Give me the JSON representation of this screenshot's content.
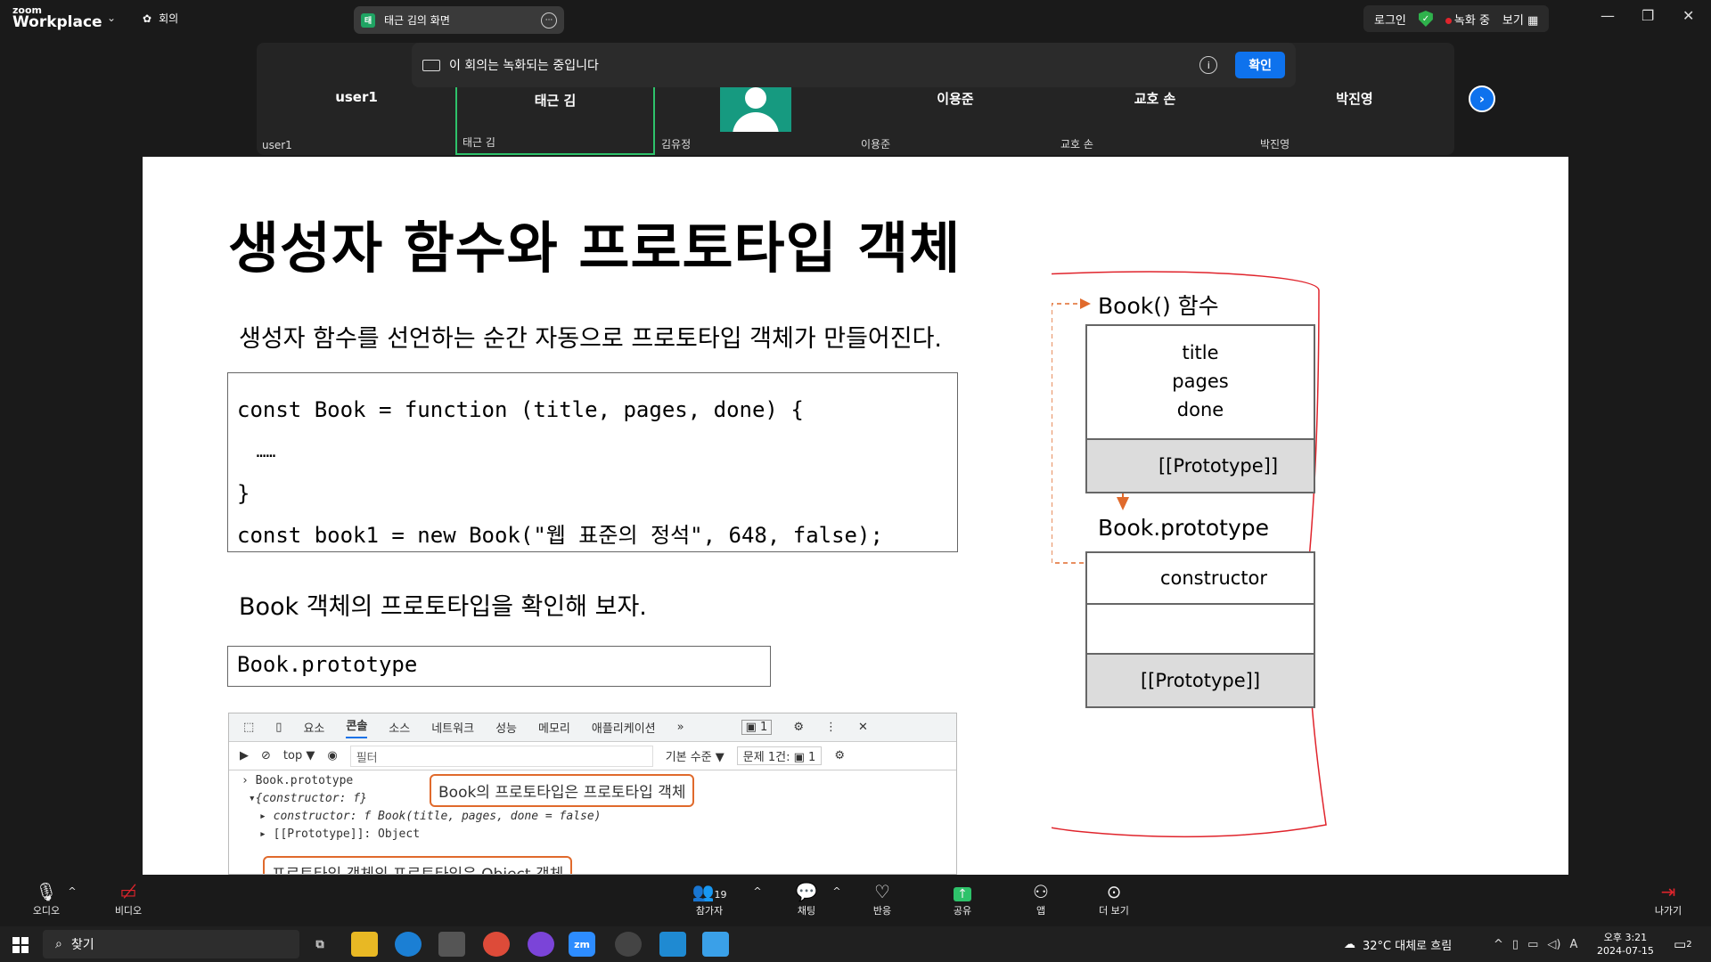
{
  "app": {
    "logo_small": "zoom",
    "logo_big": "Workplace",
    "meeting_label": "회의"
  },
  "share_tab": {
    "title": "태근 김의 화면",
    "icon_letter": "태"
  },
  "top_right": {
    "login": "로그인",
    "recording": "녹화 중",
    "view": "보기"
  },
  "notice": {
    "text": "이 회의는 녹화되는 중입니다",
    "confirm": "확인"
  },
  "participants": [
    {
      "name": "user1",
      "label": "user1"
    },
    {
      "name": "태근 김",
      "label": "태근 김"
    },
    {
      "name": "",
      "label": "김유정"
    },
    {
      "name": "이용준",
      "label": "이용준"
    },
    {
      "name": "교호 손",
      "label": "교호 손"
    },
    {
      "name": "박진영",
      "label": "박진영"
    }
  ],
  "slide": {
    "title": "생성자 함수와 프로토타입 객체",
    "subtitle": "생성자 함수를 선언하는 순간 자동으로 프로토타입 객체가 만들어진다.",
    "code_lines": [
      "const Book = function (title, pages, done) {",
      "  ……",
      "}",
      "const book1 = new Book(\"웹 표준의 정석\", 648, false);"
    ],
    "subtitle2": "Book 객체의 프로토타입을 확인해 보자.",
    "code2": "Book.prototype",
    "devtools": {
      "tabs": [
        "요소",
        "콘솔",
        "소스",
        "네트워크",
        "성능",
        "메모리",
        "애플리케이션",
        "»"
      ],
      "msg_count": "1",
      "context": "top ▼",
      "filter_placeholder": "필터",
      "level": "기본 수준 ▼",
      "issues": "문제 1건:",
      "issues_count": "1",
      "lines": [
        "Book.prototype",
        "{constructor: f}",
        "constructor: f Book(title, pages, done = false)",
        "[[Prototype]]: Object"
      ],
      "callout1": "Book의 프로토타입은 프로토타입 객체",
      "callout2": "프로토타입 객체의 프로토타입은 Object 객체"
    },
    "diagram": {
      "func_label": "Book() 함수",
      "props": [
        "title",
        "pages",
        "done"
      ],
      "proto_slot": "[[Prototype]]",
      "proto_label": "Book.prototype",
      "constructor": "constructor",
      "proto_slot2": "[[Prototype]]"
    }
  },
  "bottombar": {
    "audio": "오디오",
    "video": "비디오",
    "participants": "참가자",
    "participants_count": "19",
    "chat": "채팅",
    "react": "반응",
    "share": "공유",
    "apps": "앱",
    "more": "더 보기",
    "leave": "나가기"
  },
  "taskbar": {
    "search": "찾기",
    "weather": "32°C  대체로 흐림",
    "time": "오후 3:21",
    "date": "2024-07-15",
    "notif_count": "2",
    "ime": "A"
  },
  "colors": {
    "accent": "#0e72ed",
    "recording": "#e0242c",
    "active_tile": "#2ec26a",
    "diagram_arrow": "#e06a2c",
    "annotation_red": "#e0242c"
  }
}
